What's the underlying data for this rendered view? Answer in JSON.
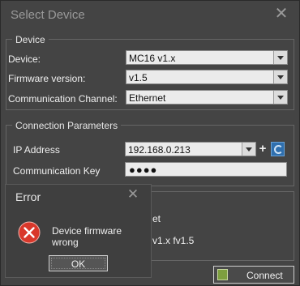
{
  "window": {
    "title": "Select Device"
  },
  "device_group": {
    "legend": "Device",
    "device_label": "Device:",
    "device_value": "MC16 v1.x",
    "firmware_label": "Firmware version:",
    "firmware_value": "v1.5",
    "channel_label": "Communication Channel:",
    "channel_value": "Ethernet"
  },
  "connection_group": {
    "legend": "Connection Parameters",
    "ip_label": "IP Address",
    "ip_value": "192.168.0.213",
    "key_label": "Communication Key",
    "key_value": "●●●●"
  },
  "summary_group": {
    "line1_partial": "et",
    "line2_partial": "v1.x fv1.5"
  },
  "connect_button": {
    "label": "Connect"
  },
  "error_dialog": {
    "title": "Error",
    "message": "Device firmware wrong",
    "ok_label": "OK"
  },
  "colors": {
    "background": "#444444",
    "error_red": "#d9382b"
  }
}
